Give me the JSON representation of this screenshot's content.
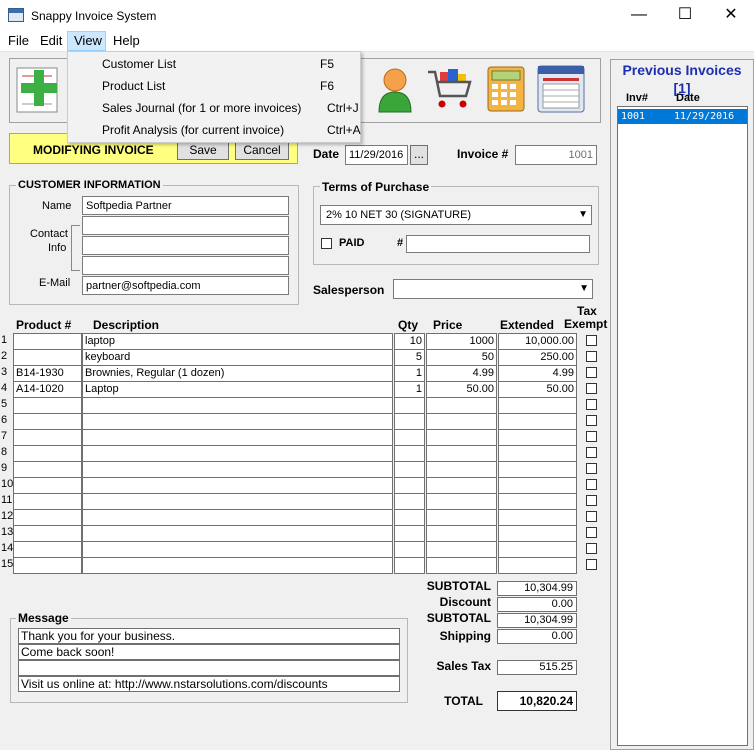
{
  "window": {
    "title": "Snappy Invoice System",
    "minimize": "—",
    "maximize": "☐",
    "close": "✕"
  },
  "menu": {
    "file": "File",
    "edit": "Edit",
    "view": "View",
    "help": "Help"
  },
  "view_menu": [
    {
      "label": "Customer List",
      "shortcut": "F5"
    },
    {
      "label": "Product List",
      "shortcut": "F6"
    },
    {
      "label": "Sales Journal  (for 1 or more invoices)",
      "shortcut": "Ctrl+J"
    },
    {
      "label": "Profit Analysis (for current invoice)",
      "shortcut": "Ctrl+A"
    }
  ],
  "toolbar_icons": [
    "new-invoice-icon",
    "salesperson-icon",
    "shopping-cart-icon",
    "calculator-icon",
    "window-list-icon"
  ],
  "status": {
    "mode": "MODIFYING INVOICE",
    "save": "Save",
    "cancel": "Cancel"
  },
  "invoice": {
    "date_label": "Date",
    "date": "11/29/2016",
    "date_btn": "...",
    "number_label": "Invoice #",
    "number": "1001"
  },
  "customer": {
    "title": "CUSTOMER INFORMATION",
    "name_label": "Name",
    "name": "Softpedia Partner",
    "contact_label": "Contact",
    "info_label": "Info",
    "contact_lines": [
      "",
      "",
      ""
    ],
    "email_label": "E-Mail",
    "email": "partner@softpedia.com"
  },
  "terms": {
    "title": "Terms of Purchase",
    "selected": "2% 10 NET 30 (SIGNATURE)",
    "paid_label": "PAID",
    "hash_label": "#",
    "paid_ref": ""
  },
  "salesperson": {
    "label": "Salesperson",
    "value": ""
  },
  "table": {
    "headers": {
      "product": "Product #",
      "description": "Description",
      "qty": "Qty",
      "price": "Price",
      "extended": "Extended",
      "tax": "Tax",
      "exempt": "Exempt"
    },
    "rows": [
      {
        "n": "1",
        "product": "",
        "description": "laptop",
        "qty": "10",
        "price": "1000",
        "extended": "10,000.00"
      },
      {
        "n": "2",
        "product": "",
        "description": "keyboard",
        "qty": "5",
        "price": "50",
        "extended": "250.00"
      },
      {
        "n": "3",
        "product": "B14-1930",
        "description": "Brownies, Regular (1 dozen)",
        "qty": "1",
        "price": "4.99",
        "extended": "4.99"
      },
      {
        "n": "4",
        "product": "A14-1020",
        "description": "Laptop",
        "qty": "1",
        "price": "50.00",
        "extended": "50.00"
      },
      {
        "n": "5",
        "product": "",
        "description": "",
        "qty": "",
        "price": "",
        "extended": ""
      },
      {
        "n": "6",
        "product": "",
        "description": "",
        "qty": "",
        "price": "",
        "extended": ""
      },
      {
        "n": "7",
        "product": "",
        "description": "",
        "qty": "",
        "price": "",
        "extended": ""
      },
      {
        "n": "8",
        "product": "",
        "description": "",
        "qty": "",
        "price": "",
        "extended": ""
      },
      {
        "n": "9",
        "product": "",
        "description": "",
        "qty": "",
        "price": "",
        "extended": ""
      },
      {
        "n": "10",
        "product": "",
        "description": "",
        "qty": "",
        "price": "",
        "extended": ""
      },
      {
        "n": "11",
        "product": "",
        "description": "",
        "qty": "",
        "price": "",
        "extended": ""
      },
      {
        "n": "12",
        "product": "",
        "description": "",
        "qty": "",
        "price": "",
        "extended": ""
      },
      {
        "n": "13",
        "product": "",
        "description": "",
        "qty": "",
        "price": "",
        "extended": ""
      },
      {
        "n": "14",
        "product": "",
        "description": "",
        "qty": "",
        "price": "",
        "extended": ""
      },
      {
        "n": "15",
        "product": "",
        "description": "",
        "qty": "",
        "price": "",
        "extended": ""
      }
    ]
  },
  "totals": {
    "subtotal_label": "SUBTOTAL",
    "subtotal": "10,304.99",
    "discount_label": "Discount",
    "discount": "0.00",
    "subtotal2_label": "SUBTOTAL",
    "subtotal2": "10,304.99",
    "shipping_label": "Shipping",
    "shipping": "0.00",
    "tax_label": "Sales Tax",
    "tax": "515.25",
    "total_label": "TOTAL",
    "total": "10,820.24"
  },
  "message": {
    "title": "Message",
    "lines": [
      "Thank you for your business.",
      "Come back soon!",
      "",
      "Visit us online at: http://www.nstarsolutions.com/discounts"
    ]
  },
  "previous": {
    "title": "Previous Invoices",
    "count": "[1]",
    "col_inv": "Inv#",
    "col_date": "Date",
    "rows": [
      {
        "inv": "1001",
        "date": "11/29/2016"
      }
    ]
  },
  "colors": {
    "accent": "#0078d7",
    "mode_bg": "#ffff80",
    "prev_title": "#1c2fb0"
  }
}
